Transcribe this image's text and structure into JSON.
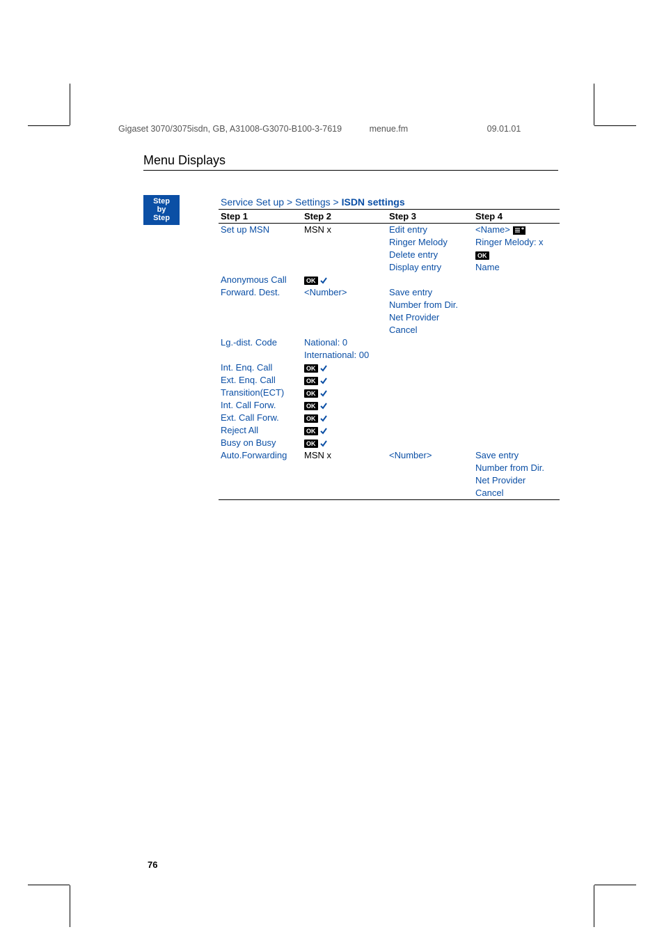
{
  "header": {
    "doc_ref": "Gigaset 3070/3075isdn, GB, A31008-G3070-B100-3-7619",
    "filename": "menue.fm",
    "date": "09.01.01"
  },
  "section_title": "Menu Displays",
  "step_tab": {
    "line1": "Step",
    "line2": "by",
    "line3": "Step"
  },
  "breadcrumb": {
    "a": "Service Set up",
    "gt1": ">",
    "b": "Settings",
    "gt2": ">",
    "c": "ISDN settings"
  },
  "columns": {
    "c1": "Step 1",
    "c2": "Step 2",
    "c3": "Step 3",
    "c4": "Step 4"
  },
  "badges": {
    "ok": "OK"
  },
  "rows": {
    "r1": {
      "c1": "Set up MSN",
      "c2": "MSN x",
      "c3": "Edit entry",
      "c4a": "<Name>"
    },
    "r2": {
      "c3": "Ringer Melody",
      "c4": "Ringer Melody: x"
    },
    "r3": {
      "c3": "Delete entry"
    },
    "r4": {
      "c3": "Display entry",
      "c4": "Name"
    },
    "r5": {
      "c1": "Anonymous Call"
    },
    "r6": {
      "c1": "Forward. Dest.",
      "c2": "<Number>",
      "c3": "Save entry"
    },
    "r7": {
      "c3": "Number from Dir."
    },
    "r8": {
      "c3": "Net Provider"
    },
    "r9": {
      "c3": "Cancel"
    },
    "r10": {
      "c1": "Lg.-dist. Code",
      "c2": "National: 0"
    },
    "r11": {
      "c2": "International: 00"
    },
    "r12": {
      "c1": "Int. Enq. Call"
    },
    "r13": {
      "c1": "Ext. Enq. Call"
    },
    "r14": {
      "c1": "Transition(ECT)"
    },
    "r15": {
      "c1": "Int. Call Forw."
    },
    "r16": {
      "c1": "Ext. Call Forw."
    },
    "r17": {
      "c1": "Reject All"
    },
    "r18": {
      "c1": "Busy on Busy"
    },
    "r19": {
      "c1": "Auto.Forwarding",
      "c2": "MSN x",
      "c3": "<Number>",
      "c4": "Save entry"
    },
    "r20": {
      "c4": "Number from Dir."
    },
    "r21": {
      "c4": "Net Provider"
    },
    "r22": {
      "c4": "Cancel"
    }
  },
  "page_number": "76"
}
